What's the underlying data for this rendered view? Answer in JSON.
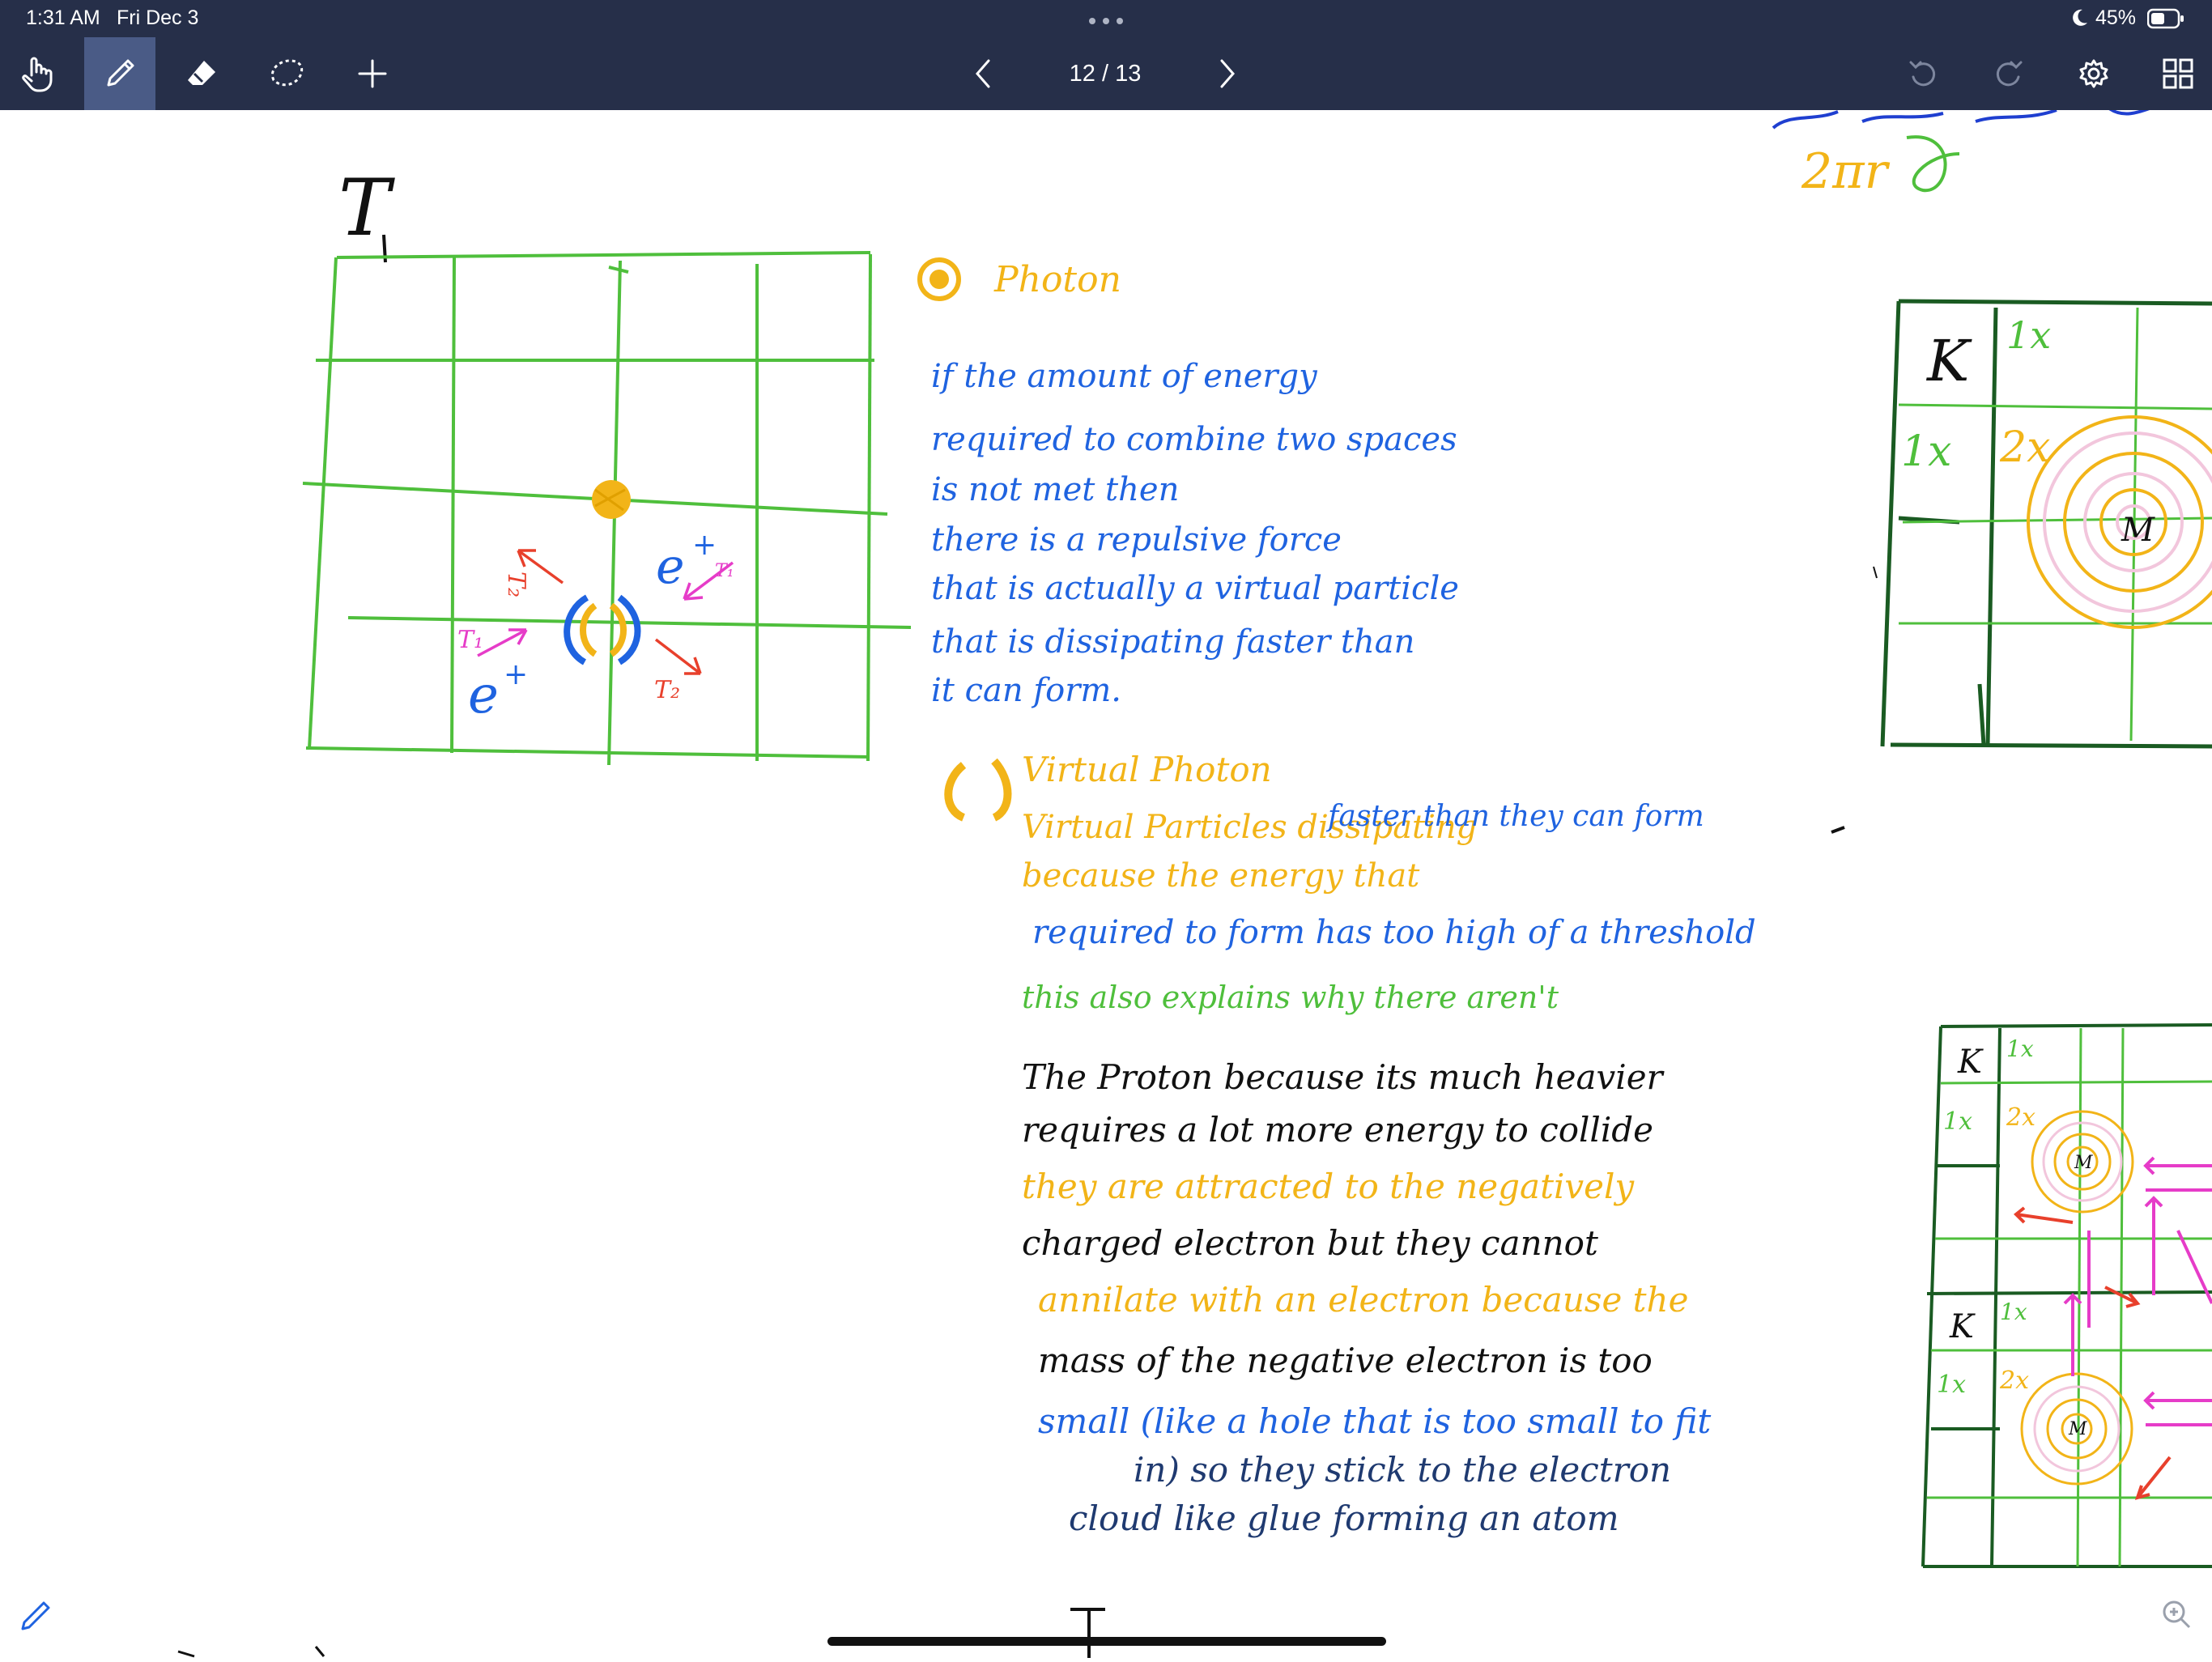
{
  "status_bar": {
    "time": "1:31 AM",
    "date": "Fri Dec 3",
    "battery_percent": "45%"
  },
  "toolbar": {
    "page_indicator": "12 / 13",
    "tools": [
      {
        "name": "hand-tool",
        "active": false
      },
      {
        "name": "pen-tool",
        "active": true
      },
      {
        "name": "eraser-tool",
        "active": false
      },
      {
        "name": "lasso-tool",
        "active": false
      },
      {
        "name": "add-tool",
        "active": false
      }
    ],
    "colors": {
      "bar": "#262f49",
      "active": "#4a5b86"
    }
  },
  "note": {
    "grid_label_top": "T",
    "grid_labels": {
      "electron_top": "e",
      "electron_bottom": "e",
      "t1_top": "T₁",
      "t1_bottom": "T₁",
      "t2_right": "T₂",
      "t2_left": "T₂"
    },
    "photon_heading": "Photon",
    "photon_lines": [
      "if the amount of energy",
      "required to combine two spaces",
      "is not met then",
      "there is a repulsive force",
      "that is actually a virtual particle",
      "that is dissipating faster than",
      "it can form."
    ],
    "virtual_heading": "Virtual Photon",
    "virtual_lines": [
      {
        "text": "Virtual Particles dissipating",
        "color": "#f2b418"
      },
      {
        "text": "faster than they can form",
        "color": "#1f63e0"
      },
      {
        "text": "because the energy that",
        "color": "#f2b418"
      },
      {
        "text": "required to form has too high of a threshold",
        "color": "#1f63e0"
      },
      {
        "text": "this also explains why there aren't",
        "color": "#4fbf3c"
      }
    ],
    "proton_lines": [
      {
        "text": "The Proton  because its much heavier",
        "color": "#111111"
      },
      {
        "text": "requires  a lot more energy to collide",
        "color": "#111111"
      },
      {
        "text": "they are attracted to  the negatively",
        "color": "#f2b418"
      },
      {
        "text": "charged electron   but they cannot",
        "color": "#111111"
      },
      {
        "text": "annilate with an electron because the",
        "color": "#f2b418"
      },
      {
        "text": "mass  of the negative electron is too",
        "color": "#111111"
      },
      {
        "text": "small (like a hole that is too small to fit",
        "color": "#1f63e0"
      },
      {
        "text": "in)  so they stick to the electron",
        "color": "#1f3a70"
      },
      {
        "text": "cloud like glue forming an atom",
        "color": "#1f3a70"
      }
    ],
    "right_grid": {
      "k": "K",
      "x1_top": "1x",
      "x1_left": "1x",
      "x2": "2x",
      "m": "M"
    },
    "bottom_grid_top": {
      "k": "K",
      "x1_top": "1x",
      "x1_left": "1x",
      "x2": "2x",
      "m": "M"
    },
    "bottom_grid_bottom": {
      "k": "K",
      "x1_top": "1x",
      "x1_left": "1x",
      "x2": "2x",
      "m": "M"
    },
    "top_right_scribble": "2πr"
  },
  "colors": {
    "green": "#4fbf3c",
    "blue": "#1f63e0",
    "yellow": "#f2b418",
    "red": "#e8402c",
    "pink": "#e63cc8",
    "dark_green": "#1a5b22"
  }
}
